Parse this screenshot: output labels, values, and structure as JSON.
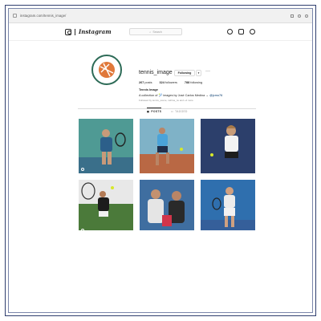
{
  "browser": {
    "url": "instagram.com/tennis_image/"
  },
  "header": {
    "logo_text": "Instagram",
    "search_placeholder": "Search"
  },
  "profile": {
    "username": "tennis_image",
    "follow_label": "Following",
    "caret": "▾",
    "more": "···",
    "stats": {
      "posts": "267",
      "posts_label": "posts",
      "followers": "324",
      "followers_label": "followers",
      "following": "788",
      "following_label": "following"
    },
    "bio_name": "Tennis Image",
    "bio_text": "A collection of 🎾 images by José Carlos Medina →",
    "bio_link": "@jcmo76",
    "followed_by": "Followed by tennis_scene, nellma_nu and +4 more"
  },
  "tabs": [
    {
      "label": "POSTS",
      "icon": "grid-icon"
    },
    {
      "label": "TAGGED",
      "icon": "tag-icon"
    }
  ],
  "colors": {
    "accent": "#2d6b57",
    "frame": "#2f3f6e",
    "link": "#00376b"
  }
}
